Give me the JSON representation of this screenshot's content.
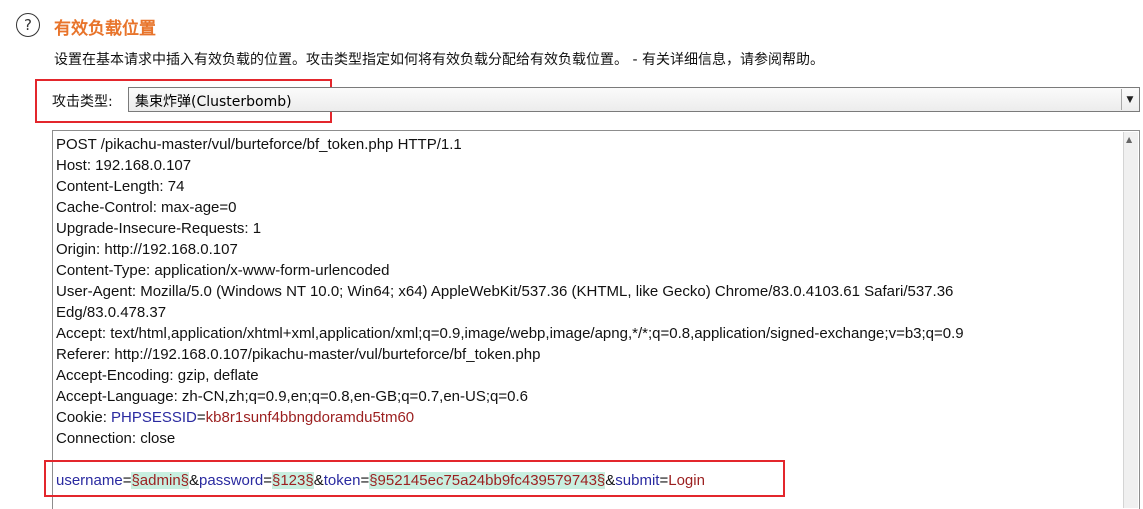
{
  "section": {
    "title": "有效负载位置",
    "description": "设置在基本请求中插入有效负载的位置。攻击类型指定如何将有效负载分配给有效负载位置。 - 有关详细信息，请参阅帮助。"
  },
  "attack_type": {
    "label": "攻击类型:",
    "value": "集束炸弹(Clusterbomb)"
  },
  "request": {
    "lines": [
      "POST /pikachu-master/vul/burteforce/bf_token.php HTTP/1.1",
      "Host: 192.168.0.107",
      "Content-Length: 74",
      "Cache-Control: max-age=0",
      "Upgrade-Insecure-Requests: 1",
      "Origin: http://192.168.0.107",
      "Content-Type: application/x-www-form-urlencoded",
      "User-Agent: Mozilla/5.0 (Windows NT 10.0; Win64; x64) AppleWebKit/537.36 (KHTML, like Gecko) Chrome/83.0.4103.61 Safari/537.36",
      "Edg/83.0.478.37",
      "Accept: text/html,application/xhtml+xml,application/xml;q=0.9,image/webp,image/apng,*/*;q=0.8,application/signed-exchange;v=b3;q=0.9",
      "Referer: http://192.168.0.107/pikachu-master/vul/burteforce/bf_token.php",
      "Accept-Encoding: gzip, deflate",
      "Accept-Language: zh-CN,zh;q=0.9,en;q=0.8,en-GB;q=0.7,en-US;q=0.6"
    ],
    "cookie": {
      "prefix": "Cookie: ",
      "name": "PHPSESSID",
      "eq": "=",
      "value": "kb8r1sunf4bbngdoramdu5tm60"
    },
    "connection": "Connection: close",
    "params": {
      "username_key": "username",
      "username_val": "§admin§",
      "password_key": "password",
      "password_val": "§123§",
      "token_key": "token",
      "token_val": "§952145ec75a24bb9fc439579743§",
      "submit_key": "submit",
      "submit_val": "Login",
      "eq": "=",
      "amp": "&"
    }
  },
  "colors": {
    "title": "#e8742b",
    "highlight_border": "#e3262c",
    "param_key": "#2a2aa0",
    "param_value": "#9b1f1f",
    "payload_marker_bg": "#c8efe0"
  },
  "icons": {
    "help": "help-circle-icon",
    "dropdown": "chevron-down-icon"
  }
}
